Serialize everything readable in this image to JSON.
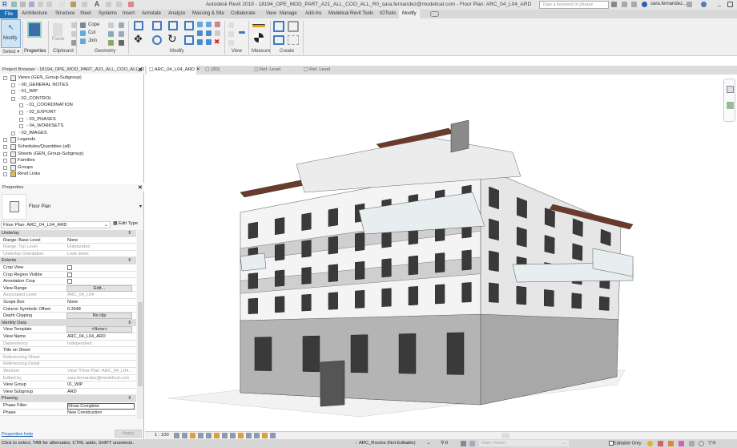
{
  "app": {
    "title": "Autodesk Revit 2019 - 18194_OPE_MOD_PART_A21_ALL_COO_ALL_R0_sara.fernandez@modelical.com - Floor Plan: ARC_04_L04_ARD",
    "search_placeholder": "Type a keyword or phrase",
    "user": "sara.fernandez...",
    "logo": "R"
  },
  "ribbon": {
    "tabs": [
      "Architecture",
      "Structure",
      "Steel",
      "Systems",
      "Insert",
      "Annotate",
      "Analyze",
      "Massing & Site",
      "Collaborate",
      "View",
      "Manage",
      "Add-Ins",
      "Modelical Revit Tools",
      "IOTools"
    ],
    "file_tab": "File",
    "active_tab": "Modify",
    "panels": [
      "Select",
      "Properties",
      "Clipboard",
      "Geometry",
      "Modify",
      "View",
      "Measure",
      "Create"
    ],
    "buttons": {
      "modify": "Modify",
      "properties": "Properties",
      "paste": "Paste",
      "cope": "Cope",
      "cut": "Cut",
      "join": "Join"
    }
  },
  "browser": {
    "title": "Project Browser - 18194_OPE_MOD_PART_A21_ALL_COO_ALL_R0...",
    "items": [
      {
        "label": "Views (GEN_Group-Subgroup)",
        "level": 0,
        "icon": "views-icon"
      },
      {
        "label": "00_GENERAL NOTES",
        "level": 1
      },
      {
        "label": "01_WIP",
        "level": 1
      },
      {
        "label": "02_CONTROL",
        "level": 1
      },
      {
        "label": "01_COORDINATION",
        "level": 2
      },
      {
        "label": "02_EXPORT",
        "level": 2
      },
      {
        "label": "03_PHASES",
        "level": 2
      },
      {
        "label": "04_WORKSETS",
        "level": 2
      },
      {
        "label": "03_IMAGES",
        "level": 1
      },
      {
        "label": "Legends",
        "level": 0,
        "icon": "legends-icon"
      },
      {
        "label": "Schedules/Quantities (all)",
        "level": 0,
        "icon": "schedules-icon"
      },
      {
        "label": "Sheets (GEN_Group-Subgroup)",
        "level": 0,
        "icon": "sheets-icon"
      },
      {
        "label": "Families",
        "level": 0,
        "icon": "families-icon"
      },
      {
        "label": "Groups",
        "level": 0,
        "icon": "groups-icon"
      },
      {
        "label": "Revit Links",
        "level": 0,
        "icon": "revit-links-icon"
      }
    ]
  },
  "properties": {
    "title": "Properties",
    "type_name": "Floor Plan",
    "selector": "Floor Plan: ARC_04_L04_ARD",
    "edit_type": "Edit Type",
    "rows": [
      {
        "section": "Underlay"
      },
      {
        "k": "Range: Base Level",
        "v": "None"
      },
      {
        "k": "Range: Top Level",
        "v": "Unbounded",
        "grey": true
      },
      {
        "k": "Underlay Orientation",
        "v": "Look down",
        "grey": true
      },
      {
        "section": "Extents"
      },
      {
        "k": "Crop View",
        "check": false
      },
      {
        "k": "Crop Region Visible",
        "check": false
      },
      {
        "k": "Annotation Crop",
        "check": false
      },
      {
        "k": "View Range",
        "btn": "Edit..."
      },
      {
        "k": "Associated Level",
        "v": "ARC_04_L04",
        "grey": true
      },
      {
        "k": "Scope Box",
        "v": "None"
      },
      {
        "k": "Column Symbolic Offset",
        "v": "0.3048"
      },
      {
        "k": "Depth Clipping",
        "btn": "No clip"
      },
      {
        "section": "Identity Data"
      },
      {
        "k": "View Template",
        "btn": "<None>"
      },
      {
        "k": "View Name",
        "v": "ARC_04_L04_ARD"
      },
      {
        "k": "Dependency",
        "v": "Independent",
        "grey": true
      },
      {
        "k": "Title on Sheet",
        "v": ""
      },
      {
        "k": "Referencing Sheet",
        "v": "",
        "grey": true
      },
      {
        "k": "Referencing Detail",
        "v": "",
        "grey": true
      },
      {
        "k": "Workset",
        "v": "View \"Floor Plan: ARC_04_L04...",
        "grey": true
      },
      {
        "k": "Edited by",
        "v": "sara.fernandez@modelical.com",
        "grey": true
      },
      {
        "k": "View Group",
        "v": "01_WIP"
      },
      {
        "k": "View Subgroup",
        "v": "ARD"
      },
      {
        "section": "Phasing"
      },
      {
        "k": "Phase Filter",
        "v": "Show Complete",
        "boxed": true
      },
      {
        "k": "Phase",
        "v": "New Construction"
      }
    ],
    "help": "Properties help",
    "apply": "Apply"
  },
  "view_tabs": [
    {
      "label": "ARC_04_L04_ARD",
      "active": true
    },
    {
      "label": "{3D}"
    },
    {
      "label": "Ref. Level"
    },
    {
      "label": "Ref. Level"
    }
  ],
  "view_control": {
    "scale": "1 : 100"
  },
  "status": {
    "hint": "Click to select, TAB for alternates, CTRL adds, SHIFT unselects.",
    "workset": "ARC_Rooms (Not Editable)",
    "workset_count": ":0",
    "design_option": "Main Model",
    "editable_only": "Editable Only",
    "filter_count": ":0"
  },
  "colors": {
    "file_tab": "#1f6fb5",
    "roof_wood": "#6b3a2a",
    "facade_white": "#f4f4f4",
    "facade_grey": "#9a9a9a"
  }
}
